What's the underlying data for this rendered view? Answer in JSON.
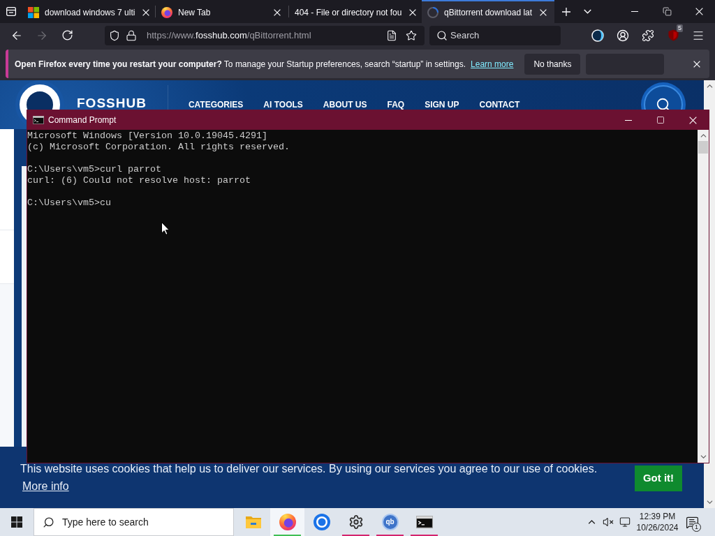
{
  "browser": {
    "tabs": [
      {
        "title": "download windows 7 ulti",
        "selected": false
      },
      {
        "title": "New Tab",
        "selected": false
      },
      {
        "title": "404 - File or directory not fou",
        "selected": false
      },
      {
        "title": "qBittorrent download lat",
        "selected": true
      }
    ],
    "nav": {
      "back_disabled": false,
      "forward_disabled": true
    },
    "url": {
      "prefix": "https://www.",
      "host": "fosshub.com",
      "path": "/qBittorrent.html"
    },
    "search": {
      "placeholder": "Search"
    },
    "extension_badge": "5"
  },
  "notification": {
    "message": "**Open Firefox every time you restart your computer?** To manage your Startup preferences, search “startup” in settings.",
    "link": "Learn more",
    "button": "No thanks"
  },
  "website": {
    "logo": "FOSSHUB",
    "menu": [
      "CATEGORIES",
      "AI TOOLS",
      "ABOUT US",
      "FAQ",
      "SIGN UP",
      "CONTACT"
    ],
    "cookie_banner": {
      "message": "This website uses cookies that help us to deliver our services. By using our services you agree to our use of cookies.",
      "link": "More info",
      "button": "Got it!"
    }
  },
  "command_prompt": {
    "title": "Command Prompt",
    "blocks": [
      [
        "Microsoft Windows [Version 10.0.19045.4291]",
        "(c) Microsoft Corporation. All rights reserved."
      ],
      [
        "C:\\Users\\vm5>curl parrot",
        "curl: (6) Could not resolve host: parrot"
      ],
      [
        "C:\\Users\\vm5>cu"
      ]
    ]
  },
  "taskbar": {
    "search_placeholder": "Type here to search",
    "apps": [
      {
        "running": false,
        "selected": false
      },
      {
        "running": true,
        "selected": true
      },
      {
        "running": false,
        "selected": false
      },
      {
        "running": true,
        "selected": false
      },
      {
        "running": true,
        "selected": false,
        "logo_text": "qb"
      },
      {
        "running": true,
        "selected": false
      }
    ],
    "clock": {
      "time": "12:39 PM",
      "date": "10/26/2024"
    },
    "notification_count": "1"
  }
}
